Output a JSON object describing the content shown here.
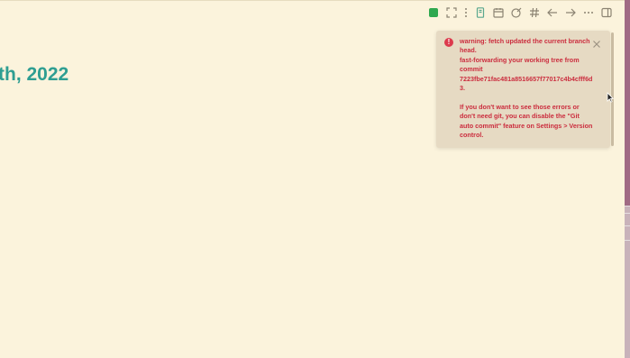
{
  "page": {
    "title": "th, 2022"
  },
  "toolbar": {
    "items": [
      {
        "name": "sync-status",
        "icon": "green-square",
        "color": "#2fa84f"
      },
      {
        "name": "fullscreen",
        "icon": "expand-icon"
      },
      {
        "name": "more-vertical",
        "icon": "kebab-icon"
      },
      {
        "name": "notebook",
        "icon": "book-icon"
      },
      {
        "name": "calendar",
        "icon": "calendar-icon"
      },
      {
        "name": "edit",
        "icon": "pencil-icon"
      },
      {
        "name": "tag",
        "icon": "hash-icon"
      },
      {
        "name": "back",
        "icon": "arrow-left-icon"
      },
      {
        "name": "forward",
        "icon": "arrow-right-icon"
      },
      {
        "name": "more",
        "icon": "ellipsis-icon"
      },
      {
        "name": "sidebar",
        "icon": "sidebar-toggle-icon"
      }
    ]
  },
  "notice": {
    "line1": "warning: fetch updated the current branch head.",
    "line2": "fast-forwarding your working tree from commit",
    "line3": "7223fbe71fac481a8516657f77017c4b4cfff6d3.",
    "line4": "If you don't want to see those errors or don't need git, you can disable the \"Git auto commit\" feature on Settings > Version control.",
    "color": "#cb2d3e"
  }
}
